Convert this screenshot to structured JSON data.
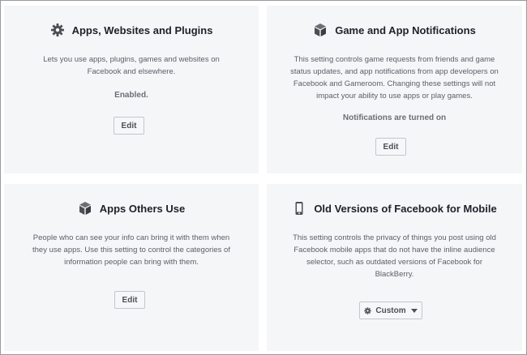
{
  "cards": [
    {
      "title": "Apps, Websites and Plugins",
      "icon": "gear-icon",
      "description": "Lets you use apps, plugins, games and websites on Facebook and elsewhere.",
      "status": "Enabled.",
      "button": "Edit"
    },
    {
      "title": "Game and App Notifications",
      "icon": "cube-icon",
      "description": "This setting controls game requests from friends and game status updates, and app notifications from app developers on Facebook and Gameroom. Changing these settings will not impact your ability to use apps or play games.",
      "status": "Notifications are turned on",
      "button": "Edit"
    },
    {
      "title": "Apps Others Use",
      "icon": "cube-icon",
      "description": "People who can see your info can bring it with them when they use apps. Use this setting to control the categories of information people can bring with them.",
      "button": "Edit"
    },
    {
      "title": "Old Versions of Facebook for Mobile",
      "icon": "mobile-phone-icon",
      "description": "This setting controls the privacy of things you post using old Facebook mobile apps that do not have the inline audience selector, such as outdated versions of Facebook for BlackBerry.",
      "dropdown": {
        "selected": "Custom",
        "icon": "gear-icon"
      }
    }
  ]
}
